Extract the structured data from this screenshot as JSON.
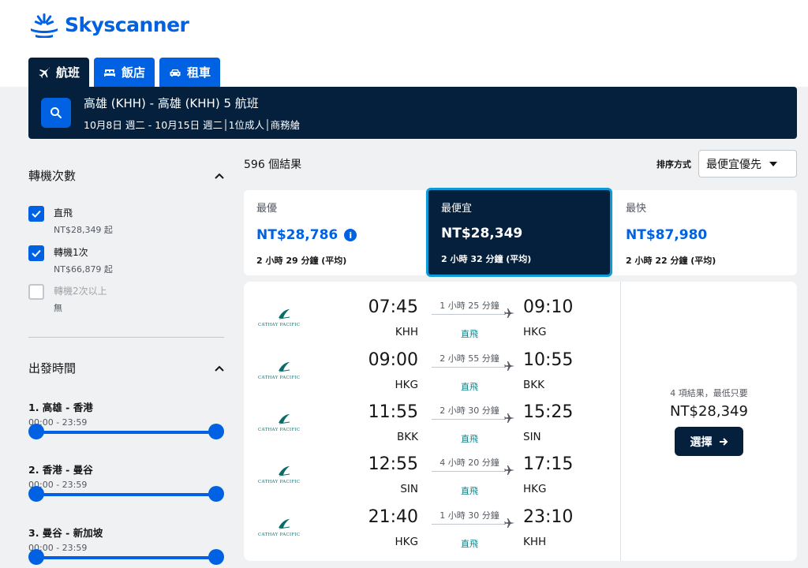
{
  "brand": {
    "name": "Skyscanner",
    "color": "#0062e3",
    "dark": "#05203c"
  },
  "tabs": [
    {
      "label": "航班",
      "icon": "plane-icon",
      "active": true
    },
    {
      "label": "飯店",
      "icon": "bed-icon",
      "active": false
    },
    {
      "label": "租車",
      "icon": "car-icon",
      "active": false
    }
  ],
  "search": {
    "route": "高雄 (KHH) - 高雄 (KHH) 5 航班",
    "dates": "10月8日 週二 - 10月15日 週二",
    "travellers": "1位成人",
    "cabin": "商務艙"
  },
  "filters": {
    "stops_title": "轉機次數",
    "stops": [
      {
        "label": "直飛",
        "sub": "NT$28,349 起",
        "checked": true,
        "disabled": false
      },
      {
        "label": "轉機1次",
        "sub": "NT$66,879 起",
        "checked": true,
        "disabled": false
      },
      {
        "label": "轉機2次以上",
        "sub": "無",
        "checked": false,
        "disabled": true
      }
    ],
    "departure_title": "出發時間",
    "sliders": [
      {
        "title": "1. 高雄 - 香港",
        "range": "00:00 - 23:59"
      },
      {
        "title": "2. 香港 - 曼谷",
        "range": "00:00 - 23:59"
      },
      {
        "title": "3. 曼谷 - 新加坡",
        "range": "00:00 - 23:59"
      }
    ]
  },
  "results": {
    "count_label": "596 個結果",
    "sort_label": "排序方式",
    "sort_value": "最便宜優先"
  },
  "sort_cards": {
    "best": {
      "title": "最優",
      "price": "NT$28,786",
      "duration": "2 小時 29 分鐘 (平均)"
    },
    "cheapest": {
      "title": "最便宜",
      "price": "NT$28,349",
      "duration": "2 小時 32 分鐘 (平均)"
    },
    "fastest": {
      "title": "最快",
      "price": "NT$87,980",
      "duration": "2 小時 22 分鐘 (平均)"
    }
  },
  "itinerary": {
    "airline": "CATHAY PACIFIC",
    "legs": [
      {
        "dep_time": "07:45",
        "dep_code": "KHH",
        "duration": "1 小時 25 分鐘",
        "stops": "直飛",
        "arr_time": "09:10",
        "arr_code": "HKG"
      },
      {
        "dep_time": "09:00",
        "dep_code": "HKG",
        "duration": "2 小時 55 分鐘",
        "stops": "直飛",
        "arr_time": "10:55",
        "arr_code": "BKK"
      },
      {
        "dep_time": "11:55",
        "dep_code": "BKK",
        "duration": "2 小時 30 分鐘",
        "stops": "直飛",
        "arr_time": "15:25",
        "arr_code": "SIN"
      },
      {
        "dep_time": "12:55",
        "dep_code": "SIN",
        "duration": "4 小時 20 分鐘",
        "stops": "直飛",
        "arr_time": "17:15",
        "arr_code": "HKG"
      },
      {
        "dep_time": "21:40",
        "dep_code": "HKG",
        "duration": "1 小時 30 分鐘",
        "stops": "直飛",
        "arr_time": "23:10",
        "arr_code": "KHH"
      }
    ],
    "price_note": "4 項結果，最低只要",
    "price": "NT$28,349",
    "select_label": "選擇"
  }
}
